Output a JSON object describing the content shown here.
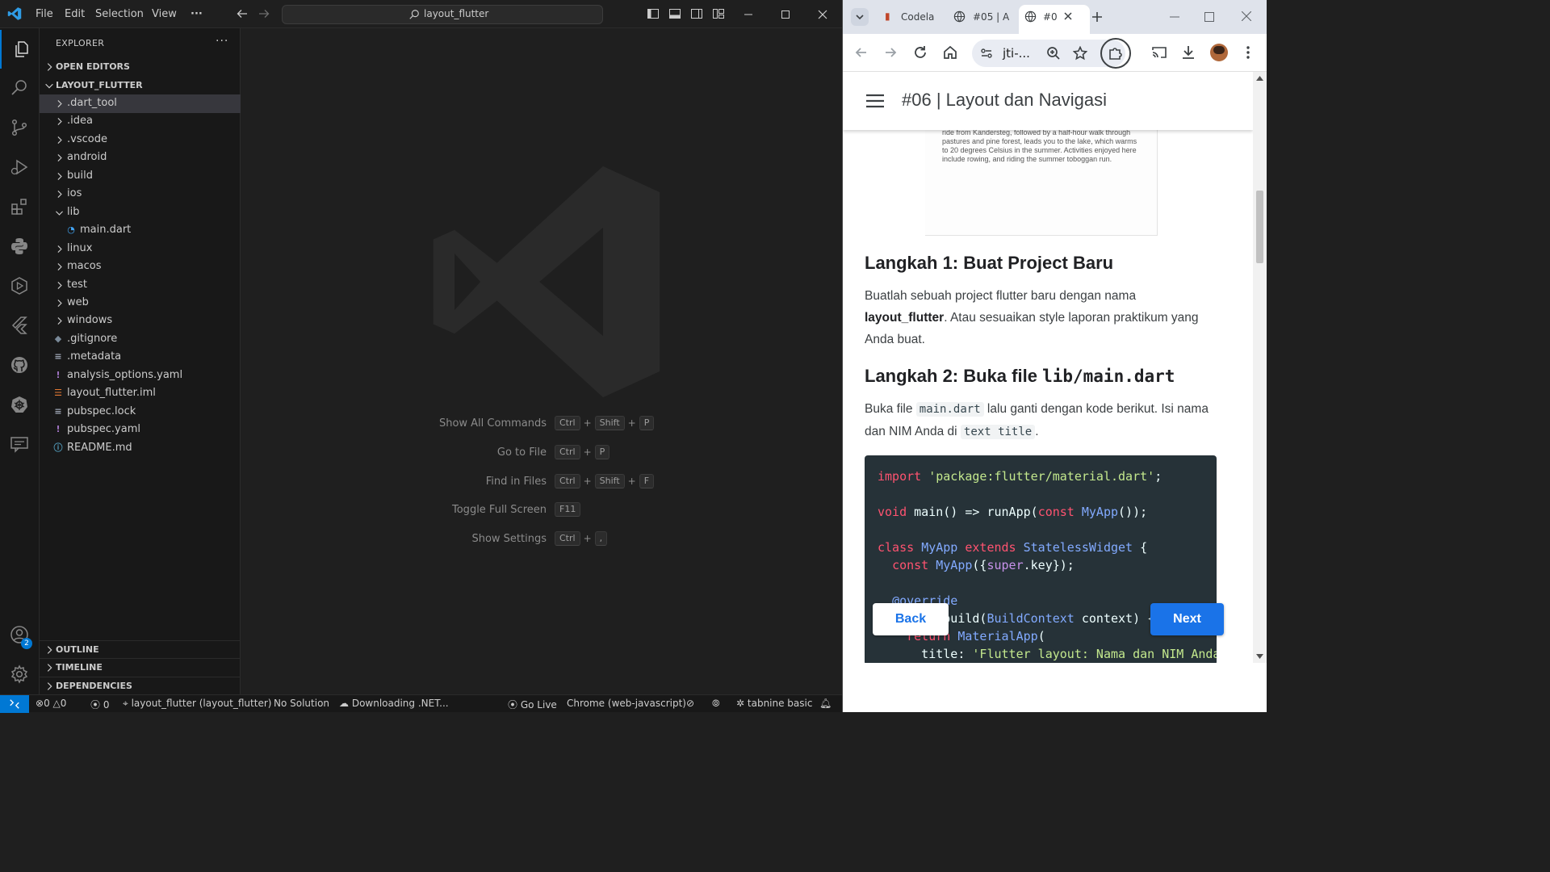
{
  "vscode": {
    "menu": [
      "File",
      "Edit",
      "Selection",
      "View",
      "···"
    ],
    "command_center": "layout_flutter",
    "explorer": {
      "header": "EXPLORER",
      "more": "···",
      "open_editors": "OPEN EDITORS",
      "project": "LAYOUT_FLUTTER",
      "items": [
        {
          "name": ".dart_tool",
          "type": "folder",
          "depth": 0,
          "expanded": false,
          "selected": true
        },
        {
          "name": ".idea",
          "type": "folder",
          "depth": 0,
          "expanded": false
        },
        {
          "name": ".vscode",
          "type": "folder",
          "depth": 0,
          "expanded": false
        },
        {
          "name": "android",
          "type": "folder",
          "depth": 0,
          "expanded": false
        },
        {
          "name": "build",
          "type": "folder",
          "depth": 0,
          "expanded": false
        },
        {
          "name": "ios",
          "type": "folder",
          "depth": 0,
          "expanded": false
        },
        {
          "name": "lib",
          "type": "folder",
          "depth": 0,
          "expanded": true
        },
        {
          "name": "main.dart",
          "type": "dart",
          "depth": 1
        },
        {
          "name": "linux",
          "type": "folder",
          "depth": 0,
          "expanded": false
        },
        {
          "name": "macos",
          "type": "folder",
          "depth": 0,
          "expanded": false
        },
        {
          "name": "test",
          "type": "folder",
          "depth": 0,
          "expanded": false
        },
        {
          "name": "web",
          "type": "folder",
          "depth": 0,
          "expanded": false
        },
        {
          "name": "windows",
          "type": "folder",
          "depth": 0,
          "expanded": false
        },
        {
          "name": ".gitignore",
          "type": "git",
          "depth": 0
        },
        {
          "name": ".metadata",
          "type": "lines",
          "depth": 0
        },
        {
          "name": "analysis_options.yaml",
          "type": "yaml",
          "depth": 0
        },
        {
          "name": "layout_flutter.iml",
          "type": "rss",
          "depth": 0
        },
        {
          "name": "pubspec.lock",
          "type": "lines",
          "depth": 0
        },
        {
          "name": "pubspec.yaml",
          "type": "yaml",
          "depth": 0
        },
        {
          "name": "README.md",
          "type": "info",
          "depth": 0
        }
      ],
      "bottom_sections": [
        "OUTLINE",
        "TIMELINE",
        "DEPENDENCIES"
      ]
    },
    "hints": [
      {
        "label": "Show All Commands",
        "keys": [
          "Ctrl",
          "Shift",
          "P"
        ]
      },
      {
        "label": "Go to File",
        "keys": [
          "Ctrl",
          "P"
        ]
      },
      {
        "label": "Find in Files",
        "keys": [
          "Ctrl",
          "Shift",
          "F"
        ]
      },
      {
        "label": "Toggle Full Screen",
        "keys": [
          "F11"
        ]
      },
      {
        "label": "Show Settings",
        "keys": [
          "Ctrl",
          ","
        ]
      }
    ],
    "accounts_badge": "2",
    "status": {
      "errors": "0",
      "warnings": "0",
      "ports": "0",
      "project": "layout_flutter (layout_flutter)",
      "solution": "No Solution",
      "download": "Downloading .NET...",
      "go_live": "Go Live",
      "device": "Chrome (web-javascript)",
      "tabnine": "tabnine basic"
    }
  },
  "chrome": {
    "tabs": [
      "Codela",
      "#05 | A",
      "#0"
    ],
    "url": "jti-...",
    "page": {
      "title": "#06 | Layout dan Navigasi",
      "card_text": "ride from Kandersteg, followed by a half-hour walk through pastures and pine forest, leads you to the lake, which warms to 20 degrees Celsius in the summer. Activities enjoyed here include rowing, and riding the summer toboggan run.",
      "step1_heading": "Langkah 1: Buat Project Baru",
      "step1_text_a": "Buatlah sebuah project flutter baru dengan nama ",
      "step1_bold": "layout_flutter",
      "step1_text_b": ". Atau sesuaikan style laporan praktikum yang Anda buat.",
      "step2_heading_a": "Langkah 2: Buka file ",
      "step2_heading_code": "lib/main.dart",
      "step2_text_a": "Buka file ",
      "step2_code1": "main.dart",
      "step2_text_b": " lalu ganti dengan kode berikut. Isi nama dan NIM Anda di ",
      "step2_code2": "text title",
      "step2_text_c": ".",
      "back_label": "Back",
      "next_label": "Next"
    }
  }
}
